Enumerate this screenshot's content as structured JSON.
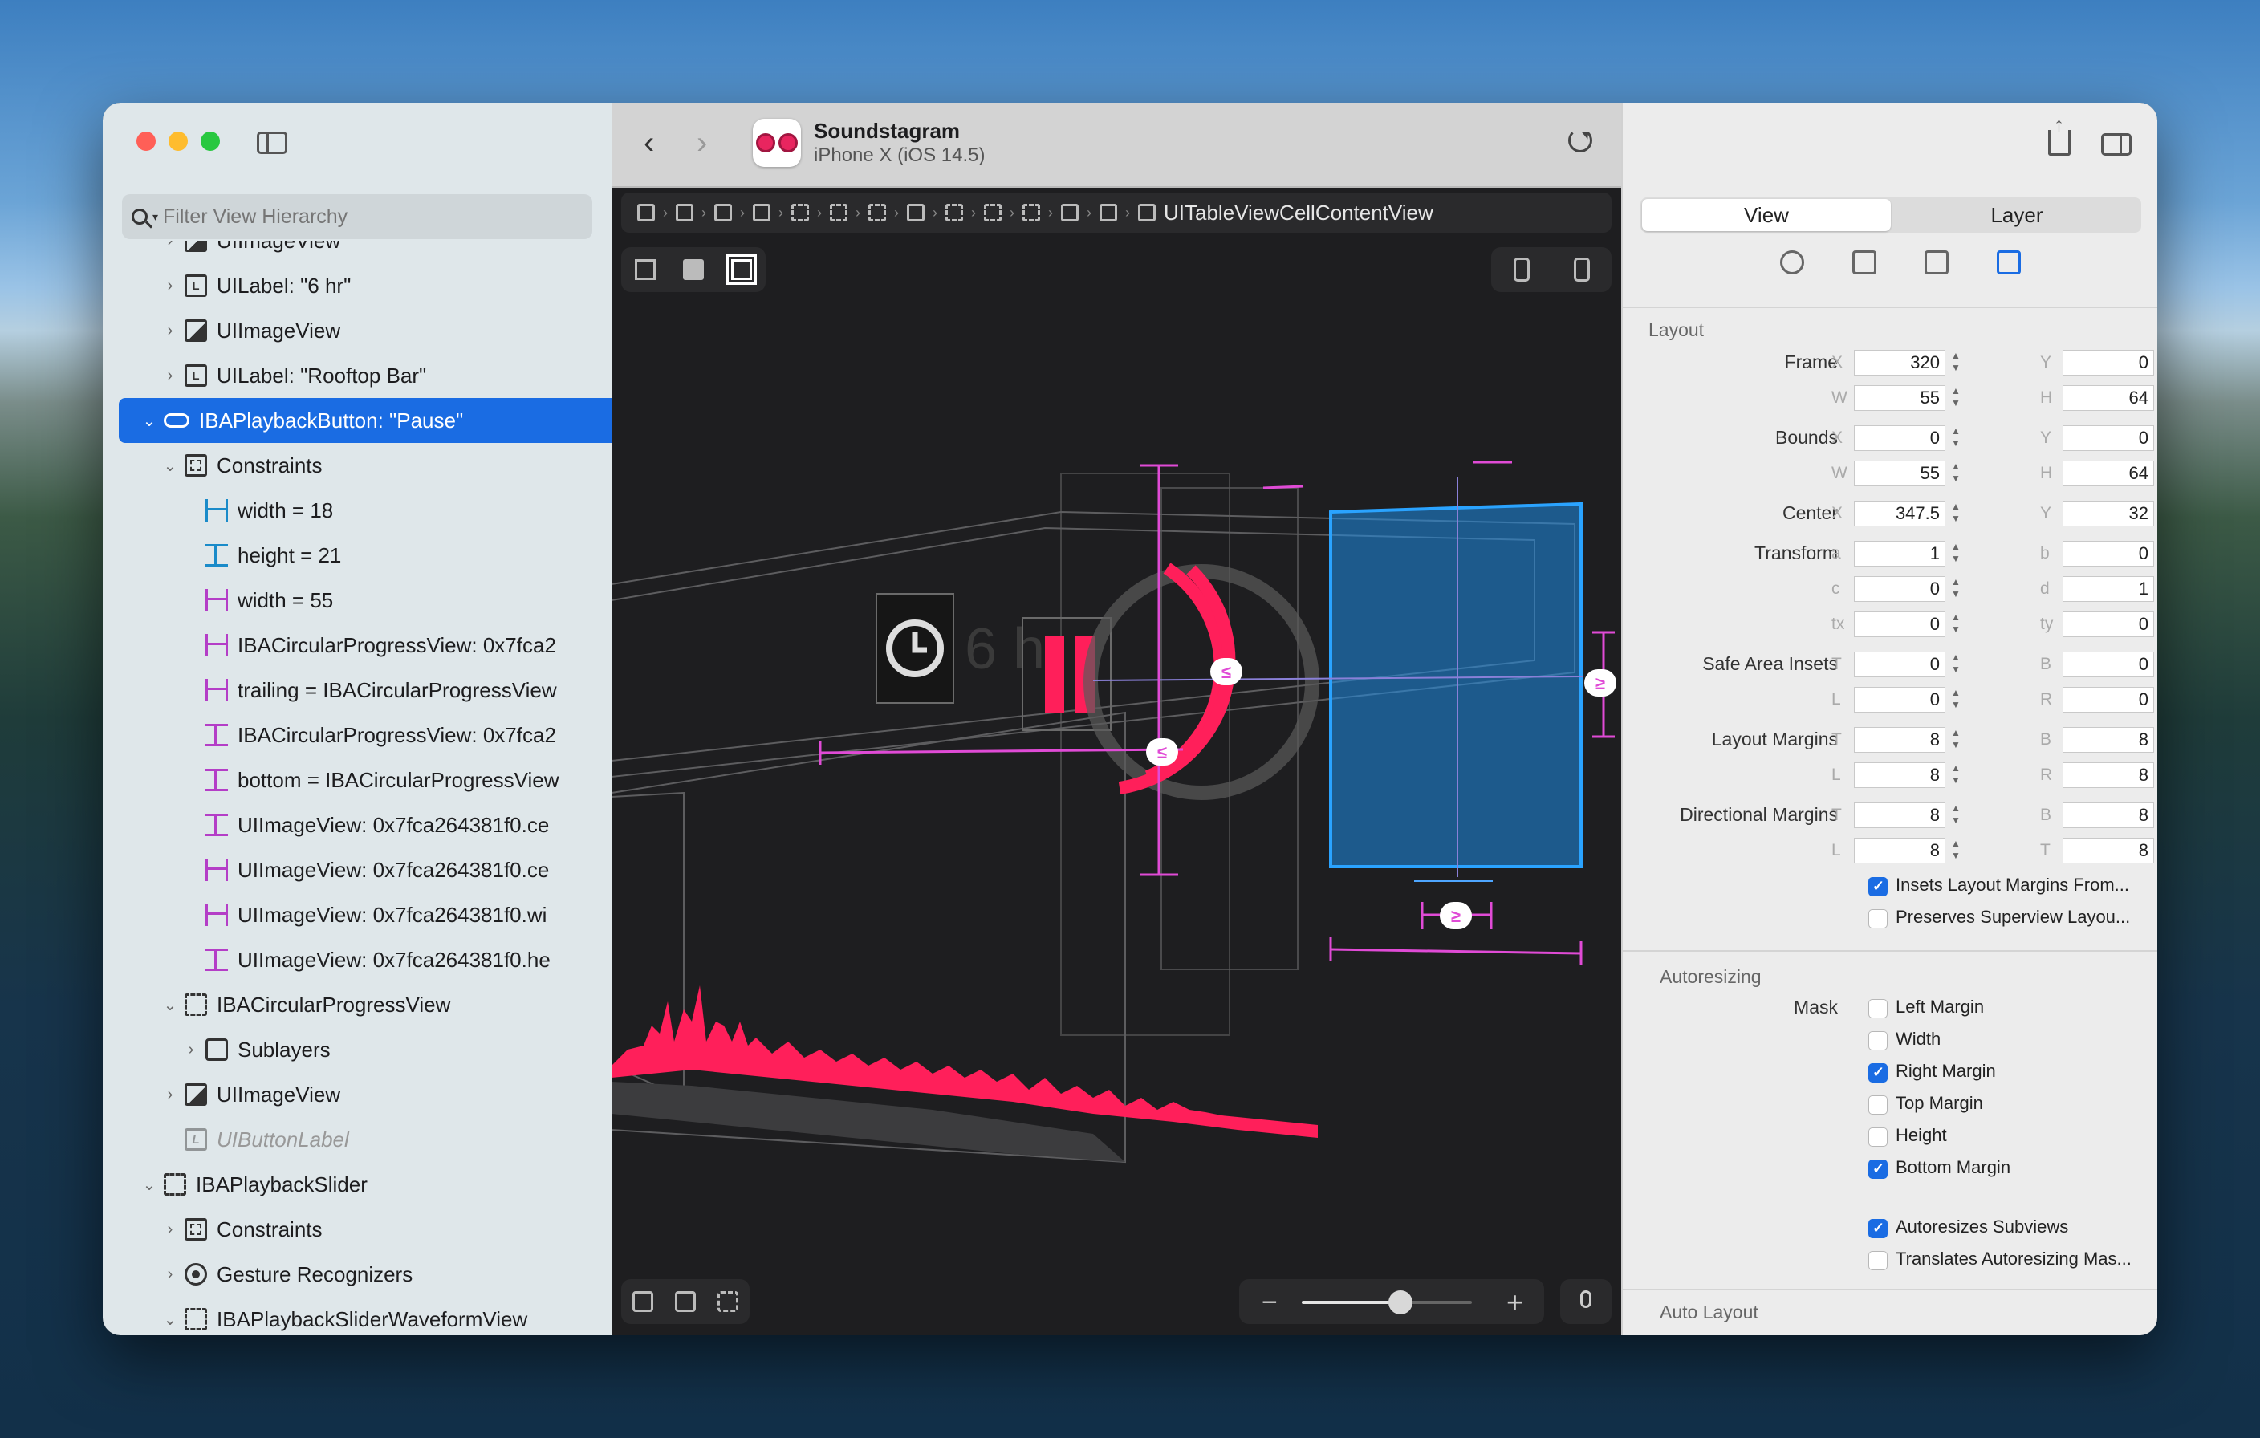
{
  "sidebar": {
    "filter_placeholder": "Filter View Hierarchy",
    "rows": [
      {
        "indent": 2,
        "disc": "›",
        "icon": "image",
        "label": "UIImageView"
      },
      {
        "indent": 2,
        "disc": "›",
        "icon": "label",
        "label": "UILabel: \"6 hr\""
      },
      {
        "indent": 2,
        "disc": "›",
        "icon": "image",
        "label": "UIImageView"
      },
      {
        "indent": 2,
        "disc": "›",
        "icon": "label",
        "label": "UILabel: \"Rooftop Bar\""
      },
      {
        "indent": 1,
        "disc": "⌄",
        "icon": "button",
        "label": "IBAPlaybackButton: \"Pause\"",
        "selected": true
      },
      {
        "indent": 2,
        "disc": "⌄",
        "icon": "constraints",
        "label": "Constraints"
      },
      {
        "indent": 3,
        "disc": "",
        "icon": "w",
        "label": "width = 18"
      },
      {
        "indent": 3,
        "disc": "",
        "icon": "h",
        "label": "height = 21"
      },
      {
        "indent": 3,
        "disc": "",
        "icon": "mw",
        "label": "width = 55"
      },
      {
        "indent": 3,
        "disc": "",
        "icon": "mw",
        "label": "IBACircularProgressView: 0x7fca2"
      },
      {
        "indent": 3,
        "disc": "",
        "icon": "mw",
        "label": "trailing = IBACircularProgressView"
      },
      {
        "indent": 3,
        "disc": "",
        "icon": "mh",
        "label": "IBACircularProgressView: 0x7fca2"
      },
      {
        "indent": 3,
        "disc": "",
        "icon": "mh",
        "label": "bottom = IBACircularProgressView"
      },
      {
        "indent": 3,
        "disc": "",
        "icon": "mh",
        "label": "UIImageView: 0x7fca264381f0.ce"
      },
      {
        "indent": 3,
        "disc": "",
        "icon": "mw",
        "label": "UIImageView: 0x7fca264381f0.ce"
      },
      {
        "indent": 3,
        "disc": "",
        "icon": "mw",
        "label": "UIImageView: 0x7fca264381f0.wi"
      },
      {
        "indent": 3,
        "disc": "",
        "icon": "mh",
        "label": "UIImageView: 0x7fca264381f0.he"
      },
      {
        "indent": 2,
        "disc": "⌄",
        "icon": "dash",
        "label": "IBACircularProgressView"
      },
      {
        "indent": 3,
        "disc": "›",
        "icon": "box",
        "label": "Sublayers"
      },
      {
        "indent": 2,
        "disc": "›",
        "icon": "image",
        "label": "UIImageView"
      },
      {
        "indent": 2,
        "disc": "",
        "icon": "label",
        "label": "UIButtonLabel",
        "faded": true
      },
      {
        "indent": 1,
        "disc": "⌄",
        "icon": "dash",
        "label": "IBAPlaybackSlider"
      },
      {
        "indent": 2,
        "disc": "›",
        "icon": "constraints",
        "label": "Constraints"
      },
      {
        "indent": 2,
        "disc": "›",
        "icon": "gesture",
        "label": "Gesture Recognizers"
      },
      {
        "indent": 2,
        "disc": "⌄",
        "icon": "dash",
        "label": "IBAPlaybackSliderWaveformView"
      }
    ]
  },
  "toolbar": {
    "app_name": "Soundstagram",
    "device": "iPhone X (iOS 14.5)",
    "breadcrumb_last": "UITableViewCellContentView"
  },
  "inspector": {
    "tabs": [
      "View",
      "Layer"
    ],
    "active_tab": "View",
    "layout_title": "Layout",
    "frame": {
      "label": "Frame",
      "x": "320",
      "y": "0",
      "w": "55",
      "h": "64"
    },
    "bounds": {
      "label": "Bounds",
      "x": "0",
      "y": "0",
      "w": "55",
      "h": "64"
    },
    "center": {
      "label": "Center",
      "x": "347.5",
      "y": "32"
    },
    "transform": {
      "label": "Transform",
      "a": "1",
      "b": "0",
      "c": "0",
      "d": "1",
      "tx": "0",
      "ty": "0"
    },
    "safe_area": {
      "label": "Safe Area Insets",
      "t": "0",
      "b": "0",
      "l": "0",
      "r": "0"
    },
    "layout_margins": {
      "label": "Layout Margins",
      "t": "8",
      "b": "8",
      "l": "8",
      "r": "8"
    },
    "directional_margins": {
      "label": "Directional Margins",
      "t": "8",
      "b": "8",
      "l": "8",
      "tr": "8"
    },
    "checks": [
      {
        "label": "Insets Layout Margins From...",
        "on": true
      },
      {
        "label": "Preserves Superview Layou...",
        "on": false
      }
    ],
    "autoresizing_title": "Autoresizing",
    "mask_label": "Mask",
    "mask": [
      {
        "label": "Left Margin",
        "on": false
      },
      {
        "label": "Width",
        "on": false
      },
      {
        "label": "Right Margin",
        "on": true
      },
      {
        "label": "Top Margin",
        "on": false
      },
      {
        "label": "Height",
        "on": false
      },
      {
        "label": "Bottom Margin",
        "on": true
      }
    ],
    "autoresizes": {
      "label": "Autoresizes Subviews",
      "on": true
    },
    "translates": {
      "label": "Translates Autoresizing Mas...",
      "on": false
    },
    "autolayout_title": "Auto Layout"
  },
  "canvas": {
    "label_text": "6 h",
    "ge_symbol": "≥",
    "le_symbol": "≤",
    "colors": {
      "accent": "#ff1f5a",
      "selection": "#1f8fe6",
      "constraint": "#e04bd6"
    }
  }
}
